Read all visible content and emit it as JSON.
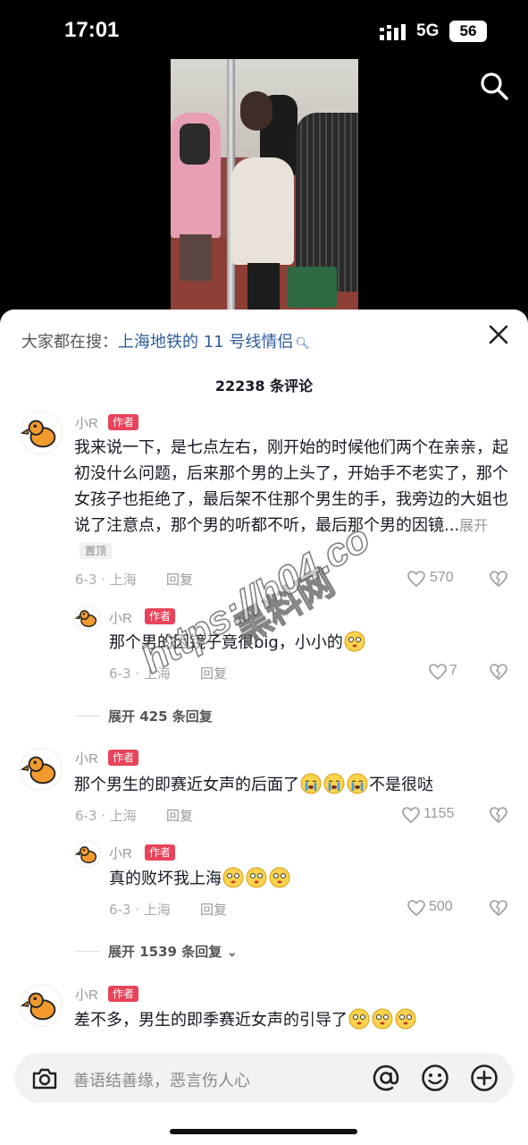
{
  "status_bar": {
    "time": "17:01",
    "network": "5G",
    "battery": "56"
  },
  "search_hint": {
    "label": "大家都在搜：",
    "query": "上海地铁的 11 号线情侣"
  },
  "comment_count": "22238 条评论",
  "comments": [
    {
      "user": "小R",
      "badge": "作者",
      "text": "我来说一下，是七点左右，刚开始的时候他们两个在亲亲，起初没什么问题，后来那个男的上头了，开始手不老实了，那个女孩子也拒绝了，最后架不住那个男生的手，我旁边的大姐也说了注意点，那个男的听都不听，最后那个男的因镜...",
      "more_label": "展开",
      "pinned_label": "置顶",
      "date_loc": "6-3 · 上海",
      "reply_label": "回复",
      "likes": "570",
      "sub_reply": {
        "user": "小R",
        "badge": "作者",
        "text": "那个男的因镜子竟很big，小小的",
        "date_loc": "6-3 · 上海",
        "reply_label": "回复",
        "likes": "7"
      },
      "expand_label": "展开 425 条回复"
    },
    {
      "user": "小R",
      "badge": "作者",
      "text": "那个男生的即赛近女声的后面了",
      "text_suffix": "不是很哒",
      "date_loc": "6-3 · 上海",
      "reply_label": "回复",
      "likes": "1155",
      "sub_reply": {
        "user": "小R",
        "badge": "作者",
        "text": "真的败坏我上海",
        "date_loc": "6-3 · 上海",
        "reply_label": "回复",
        "likes": "500"
      },
      "expand_label": "展开 1539 条回复"
    },
    {
      "user": "小R",
      "badge": "作者",
      "text": "差不多，男生的即季赛近女声的引导了"
    }
  ],
  "watermark": {
    "line1": "https://h04.co",
    "line2": "黑料网"
  },
  "input": {
    "placeholder": "善语结善缘，恶言伤人心"
  },
  "colors": {
    "accent_badge": "#e9435a",
    "link": "#2e5d9a"
  }
}
